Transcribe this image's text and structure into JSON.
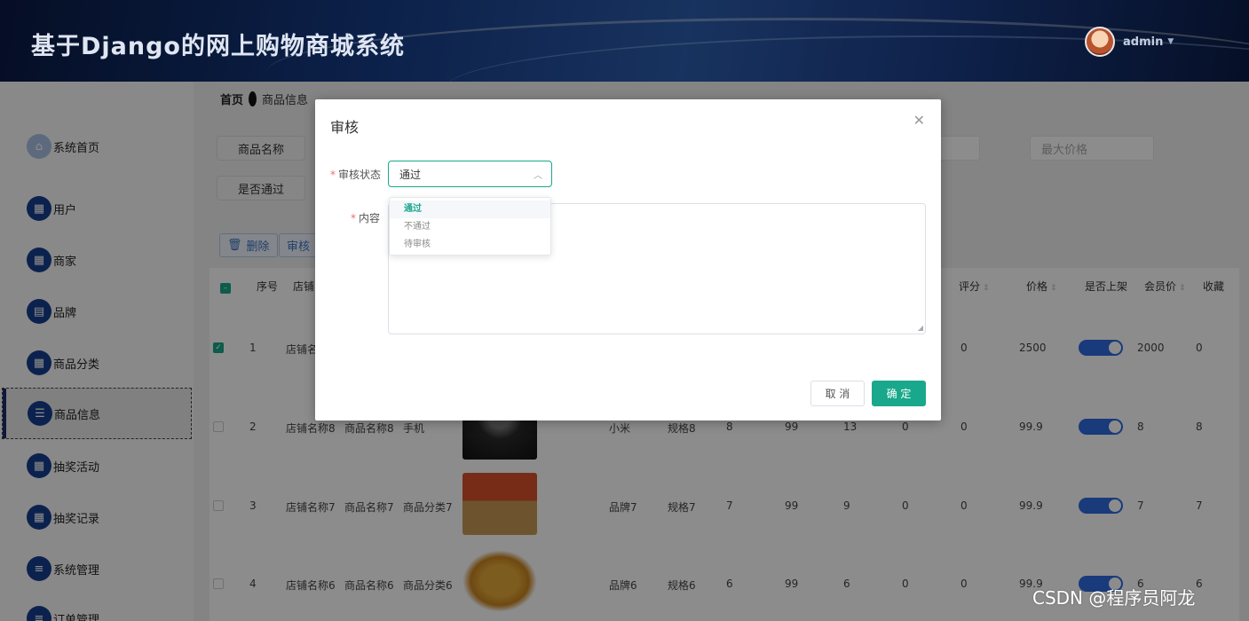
{
  "header": {
    "title": "基于Django的网上购物商城系统",
    "user": "admin"
  },
  "sidebar": {
    "items": [
      {
        "label": "系统首页",
        "icon": "home-icon"
      },
      {
        "label": "用户",
        "icon": "grid-icon"
      },
      {
        "label": "商家",
        "icon": "grid-icon"
      },
      {
        "label": "品牌",
        "icon": "clipboard-icon"
      },
      {
        "label": "商品分类",
        "icon": "grid-icon"
      },
      {
        "label": "商品信息",
        "icon": "list-icon",
        "active": true
      },
      {
        "label": "抽奖活动",
        "icon": "grid-icon"
      },
      {
        "label": "抽奖记录",
        "icon": "grid-icon"
      },
      {
        "label": "系统管理",
        "icon": "menu-icon"
      },
      {
        "label": "订单管理",
        "icon": "menu-icon"
      }
    ]
  },
  "breadcrumb": {
    "home": "首页",
    "current": "商品信息"
  },
  "filters": {
    "name_label": "商品名称",
    "approved_label": "是否通过",
    "max_price_placeholder": "最大价格"
  },
  "toolbar": {
    "delete_label": "删除",
    "audit_label": "审核"
  },
  "table": {
    "headers": [
      "序号",
      "店铺",
      "评分",
      "价格",
      "是否上架",
      "会员价",
      "收藏"
    ],
    "rows": [
      {
        "index": "1",
        "shop": "店铺名称",
        "rating": "0",
        "price": "2500",
        "member_price": "2000",
        "favorites": "0",
        "checked": true
      },
      {
        "index": "2",
        "shop": "店铺名称8",
        "name": "商品名称8",
        "category": "手机",
        "brand": "小米",
        "spec": "规格8",
        "c1": "8",
        "c2": "99",
        "c3": "13",
        "c4": "0",
        "rating": "0",
        "price": "99.9",
        "member_price": "8",
        "favorites": "8"
      },
      {
        "index": "3",
        "shop": "店铺名称7",
        "name": "商品名称7",
        "category": "商品分类7",
        "brand": "品牌7",
        "spec": "规格7",
        "c1": "7",
        "c2": "99",
        "c3": "9",
        "c4": "0",
        "rating": "0",
        "price": "99.9",
        "member_price": "7",
        "favorites": "7"
      },
      {
        "index": "4",
        "shop": "店铺名称6",
        "name": "商品名称6",
        "category": "商品分类6",
        "brand": "品牌6",
        "spec": "规格6",
        "c1": "6",
        "c2": "99",
        "c3": "6",
        "c4": "0",
        "rating": "0",
        "price": "99.9",
        "member_price": "6",
        "favorites": "6"
      }
    ]
  },
  "dialog": {
    "title": "审核",
    "status_label": "审核状态",
    "status_value": "通过",
    "content_label": "内容",
    "options": [
      "通过",
      "不通过",
      "待审核"
    ],
    "cancel_label": "取 消",
    "ok_label": "确 定"
  },
  "watermark": "CSDN @程序员阿龙",
  "colors": {
    "accent": "#19a88b",
    "nav": "#163e8e",
    "toggle": "#2f6be0"
  }
}
